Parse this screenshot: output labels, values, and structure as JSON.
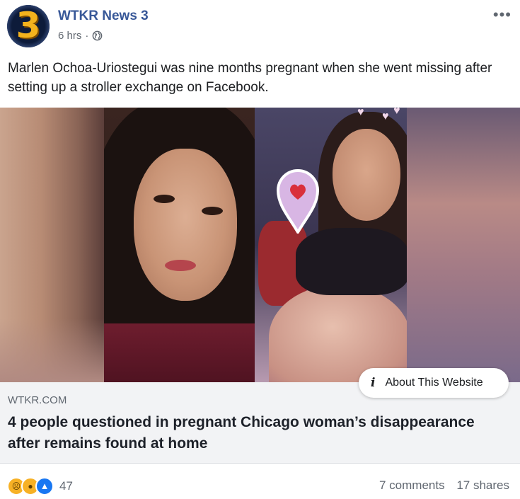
{
  "post": {
    "page_name": "WTKR News 3",
    "avatar_text": "3",
    "time": "6 hrs",
    "separator": "·",
    "privacy_icon": "globe-icon",
    "more_icon": "•••",
    "text": "Marlen Ochoa-Uriostegui was nine months pregnant when she went missing after setting up a stroller exchange on Facebook."
  },
  "link": {
    "domain": "WTKR.COM",
    "title": "4 people questioned in pregnant Chicago woman’s disappearance after remains found at home",
    "about_label": "About This Website",
    "info_icon": "i"
  },
  "engagement": {
    "reactions": [
      "sad-icon",
      "wow-icon",
      "like-icon"
    ],
    "reaction_count": "47",
    "comments": "7 comments",
    "shares": "17 shares"
  },
  "colors": {
    "page_name": "#385898",
    "muted": "#606770",
    "link_bg": "#f2f3f5",
    "like": "#1877f2",
    "react_yellow": "#f7b125"
  }
}
